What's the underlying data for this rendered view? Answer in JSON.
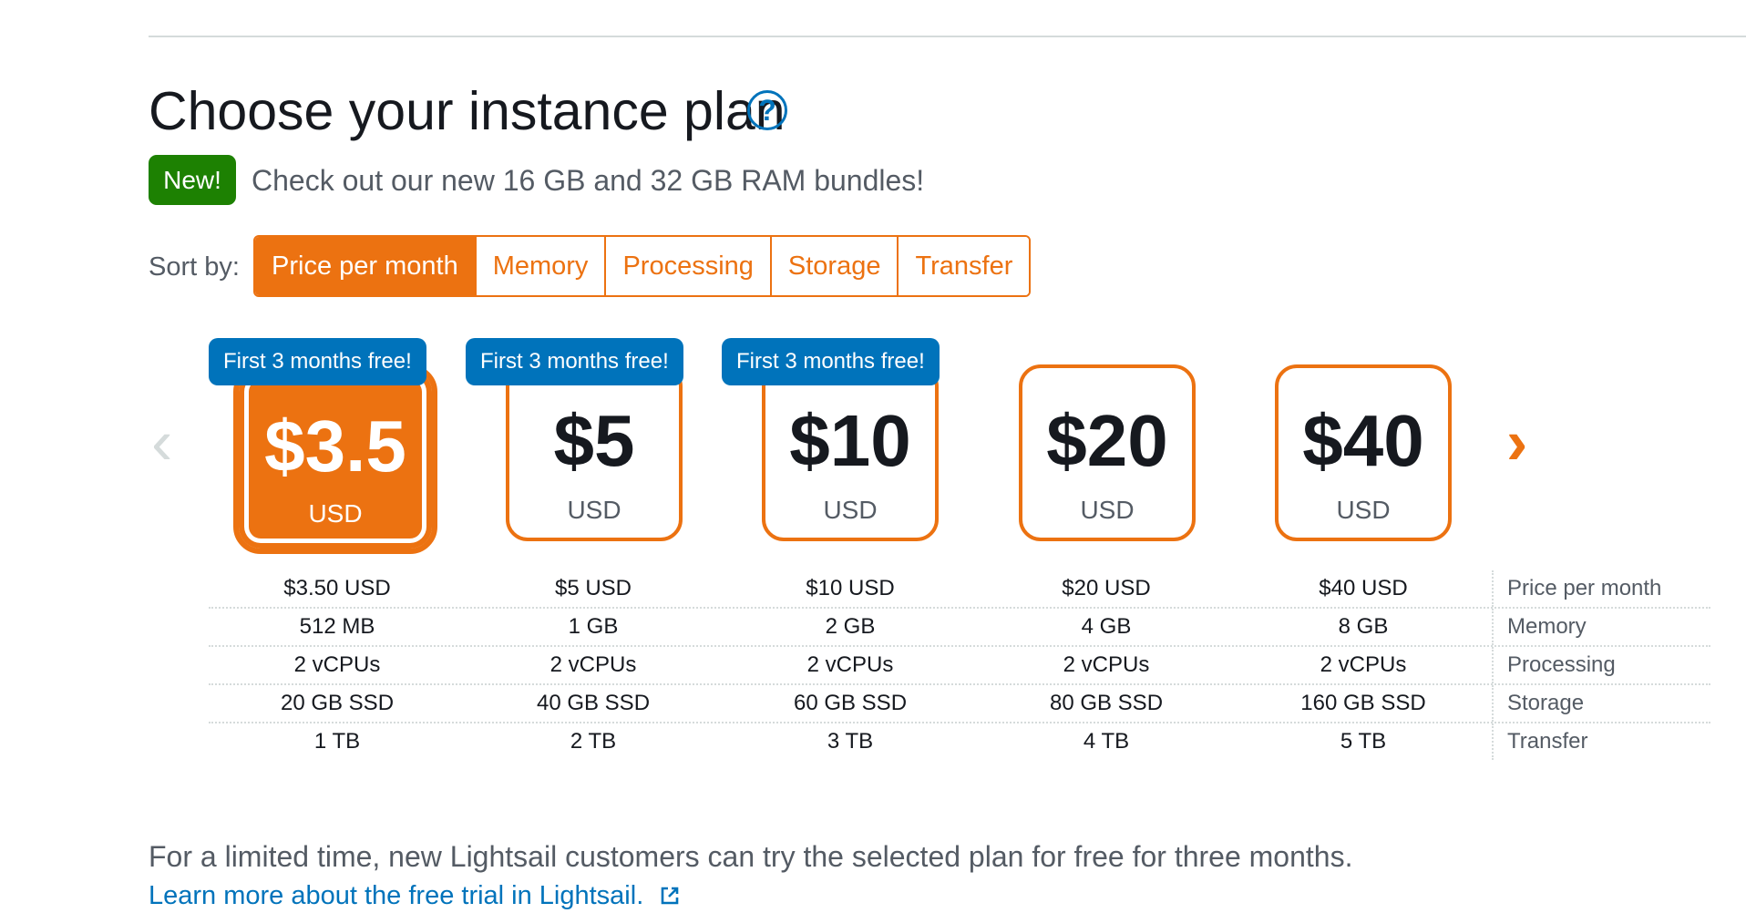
{
  "header": {
    "title": "Choose your instance plan",
    "help_icon_glyph": "?"
  },
  "announcement": {
    "badge": "New!",
    "text": "Check out our new 16 GB and 32 GB RAM bundles!"
  },
  "sort": {
    "label": "Sort by:",
    "options": [
      "Price per month",
      "Memory",
      "Processing",
      "Storage",
      "Transfer"
    ],
    "active": "Price per month"
  },
  "carousel": {
    "prev_icon": "chevron-left-icon",
    "next_icon": "chevron-right-icon",
    "prev_glyph": "‹",
    "next_glyph": "›"
  },
  "plans": [
    {
      "ribbon": "First 3 months free!",
      "price": "$3.5",
      "currency": "USD",
      "selected": true,
      "price_per_month": "$3.50 USD",
      "memory": "512 MB",
      "processing": "2 vCPUs",
      "storage": "20 GB SSD",
      "transfer": "1 TB"
    },
    {
      "ribbon": "First 3 months free!",
      "price": "$5",
      "currency": "USD",
      "selected": false,
      "price_per_month": "$5 USD",
      "memory": "1 GB",
      "processing": "2 vCPUs",
      "storage": "40 GB SSD",
      "transfer": "2 TB"
    },
    {
      "ribbon": "First 3 months free!",
      "price": "$10",
      "currency": "USD",
      "selected": false,
      "price_per_month": "$10 USD",
      "memory": "2 GB",
      "processing": "2 vCPUs",
      "storage": "60 GB SSD",
      "transfer": "3 TB"
    },
    {
      "ribbon": "",
      "price": "$20",
      "currency": "USD",
      "selected": false,
      "price_per_month": "$20 USD",
      "memory": "4 GB",
      "processing": "2 vCPUs",
      "storage": "80 GB SSD",
      "transfer": "4 TB"
    },
    {
      "ribbon": "",
      "price": "$40",
      "currency": "USD",
      "selected": false,
      "price_per_month": "$40 USD",
      "memory": "8 GB",
      "processing": "2 vCPUs",
      "storage": "160 GB SSD",
      "transfer": "5 TB"
    }
  ],
  "spec_labels": {
    "price_per_month": "Price per month",
    "memory": "Memory",
    "processing": "Processing",
    "storage": "Storage",
    "transfer": "Transfer"
  },
  "footer": {
    "text": "For a limited time, new Lightsail customers can try the selected plan for free for three months.",
    "link": "Learn more about the free trial in Lightsail."
  },
  "colors": {
    "accent": "#ec7211",
    "badge_green": "#1d8102",
    "ribbon_blue": "#0073bb",
    "link_blue": "#0073bb",
    "muted_text": "#545b64"
  }
}
